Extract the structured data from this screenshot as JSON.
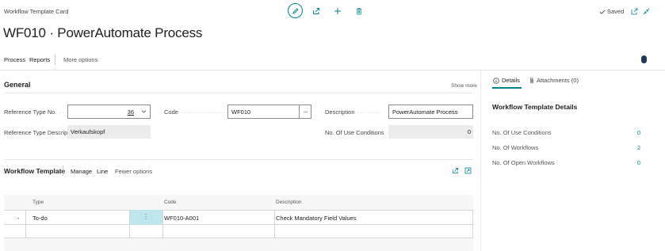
{
  "header": {
    "breadcrumb": "Workflow Template Card",
    "title": "WF010 · PowerAutomate Process",
    "saved_label": "Saved",
    "icons": [
      "edit-icon",
      "share-icon",
      "add-icon",
      "delete-icon",
      "checkmark-icon",
      "open-new-window-icon",
      "collapse-icon"
    ]
  },
  "action_bar": {
    "process": "Process",
    "reports": "Reports",
    "more_options": "More options"
  },
  "general": {
    "title": "General",
    "show_more": "Show more",
    "reference_type_no_label": "Reference Type No.",
    "reference_type_no_value": "36",
    "code_label": "Code",
    "code_value": "WF010",
    "description_label": "Description",
    "description_value": "PowerAutomate Process",
    "reference_type_description_label": "Reference Type Descripti...",
    "reference_type_description_value": "Verkaufskopf",
    "no_of_use_conditions_label": "No. Of Use Conditions",
    "no_of_use_conditions_value": "0"
  },
  "subpage": {
    "title": "Workflow Template",
    "manage": "Manage",
    "line": "Line",
    "fewer_options": "Fewer options",
    "columns": {
      "type": "Type",
      "code": "Code",
      "description": "Description"
    },
    "rows": [
      {
        "arrow": "→",
        "type": "To-do",
        "menu": "⋮",
        "code": "WF010-A001",
        "description": "Check Mandatory Field Values"
      }
    ]
  },
  "factbox": {
    "tab_details": "Details",
    "tab_attachments": "Attachments (0)",
    "title": "Workflow Template Details",
    "rows": [
      {
        "label": "No. Of Use Conditions",
        "value": "0"
      },
      {
        "label": "No. Of Workflows",
        "value": "2"
      },
      {
        "label": "No. Of Open Workflows",
        "value": "0"
      }
    ]
  },
  "colors": {
    "accent": "#008489",
    "navy": "#1b3a57",
    "readonly_bg": "#ececec",
    "selected_cell_bg": "#bfe6ec"
  }
}
